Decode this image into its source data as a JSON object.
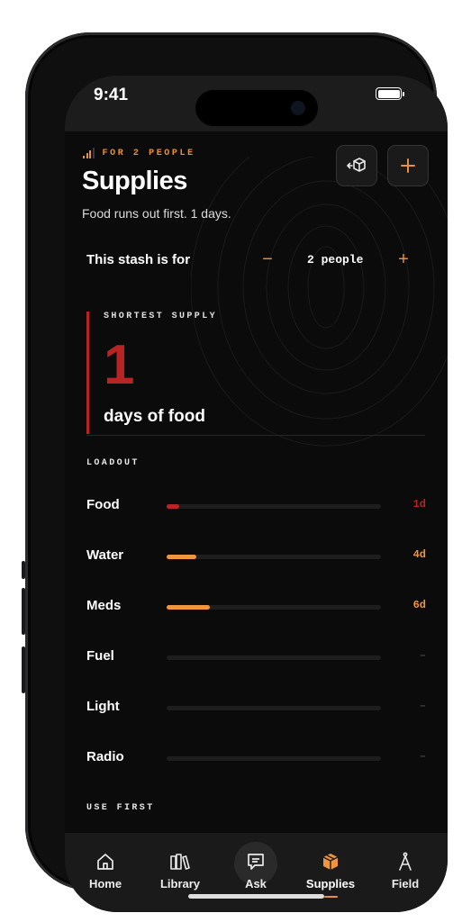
{
  "status": {
    "time": "9:41"
  },
  "header": {
    "eyebrow": "FOR 2 PEOPLE",
    "title": "Supplies",
    "subtitle": "Food runs out first. 1 days.",
    "actions": [
      {
        "icon": "box-share-icon"
      },
      {
        "icon": "plus-icon",
        "label": "+"
      }
    ]
  },
  "stash": {
    "label": "This stash is for",
    "minus": "−",
    "plus": "+",
    "count": "2 people"
  },
  "shortest": {
    "label": "SHORTEST SUPPLY",
    "value": "1",
    "unit": "days of food"
  },
  "loadout": {
    "label": "LOADOUT",
    "items": [
      {
        "name": "Food",
        "value": "1d",
        "fill": 0.06,
        "color": "#b82424"
      },
      {
        "name": "Water",
        "value": "4d",
        "fill": 0.14,
        "color": "#f0953e"
      },
      {
        "name": "Meds",
        "value": "6d",
        "fill": 0.2,
        "color": "#f0953e"
      },
      {
        "name": "Fuel",
        "value": "–",
        "fill": 0,
        "color": "#3a3a3a"
      },
      {
        "name": "Light",
        "value": "–",
        "fill": 0,
        "color": "#3a3a3a"
      },
      {
        "name": "Radio",
        "value": "–",
        "fill": 0,
        "color": "#3a3a3a"
      }
    ]
  },
  "use_first": {
    "label": "USE FIRST"
  },
  "tabs": [
    {
      "label": "Home",
      "icon": "home-icon"
    },
    {
      "label": "Library",
      "icon": "library-icon"
    },
    {
      "label": "Ask",
      "icon": "chat-icon"
    },
    {
      "label": "Supplies",
      "icon": "box-icon",
      "active": true
    },
    {
      "label": "Field",
      "icon": "compass-icon"
    }
  ],
  "colors": {
    "accent": "#e8913a",
    "danger": "#b82424",
    "background": "#0b0b0b"
  }
}
